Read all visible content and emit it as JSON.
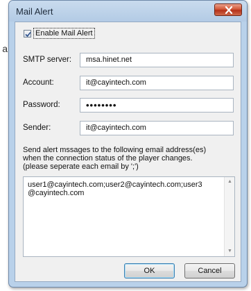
{
  "background_fragment": "a",
  "dialog": {
    "title": "Mail Alert",
    "close_icon": "close-x-icon"
  },
  "enable_checkbox": {
    "label": "Enable Mail Alert",
    "checked": true
  },
  "fields": {
    "smtp_label": "SMTP server:",
    "smtp_value": "msa.hinet.net",
    "account_label": "Account:",
    "account_value": "it@cayintech.com",
    "password_label": "Password:",
    "password_value": "••••••••",
    "sender_label": "Sender:",
    "sender_value": "it@cayintech.com"
  },
  "description": {
    "line1": "Send alert mssages to the following email address(es)",
    "line2": "when the connection status of the player changes.",
    "line3": "(please seperate each email by ';')"
  },
  "recipients": {
    "line1": "user1@cayintech.com;user2@cayintech.com;user3",
    "line2": "@cayintech.com"
  },
  "buttons": {
    "ok": "OK",
    "cancel": "Cancel"
  },
  "colors": {
    "frame": "#b9d1ea",
    "close_button": "#c7432a",
    "client_bg": "#f0f0f0"
  }
}
